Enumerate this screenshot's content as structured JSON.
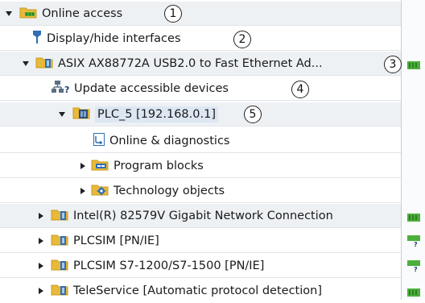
{
  "tree": {
    "root": {
      "label": "Online access"
    },
    "display_hide": {
      "label": "Display/hide interfaces"
    },
    "adapter_asix": {
      "label": "ASIX AX88772A USB2.0 to Fast Ethernet Ad..."
    },
    "update_devices": {
      "label": "Update accessible devices"
    },
    "plc": {
      "label": "PLC_5 [192.168.0.1]"
    },
    "online_diag": {
      "label": "Online & diagnostics"
    },
    "program_blocks": {
      "label": "Program blocks"
    },
    "technology_objects": {
      "label": "Technology objects"
    },
    "adapter_intel": {
      "label": "Intel(R) 82579V Gigabit Network Connection"
    },
    "plcsim": {
      "label": "PLCSIM [PN/IE]"
    },
    "plcsim_s7": {
      "label": "PLCSIM S7-1200/S7-1500 [PN/IE]"
    },
    "teleservice": {
      "label": "TeleService [Automatic protocol detection]"
    }
  },
  "callouts": [
    "1",
    "2",
    "3",
    "4",
    "5"
  ],
  "colors": {
    "folder": "#e8b93a",
    "folder_dark": "#c99a1c",
    "network_green": "#4caf3c",
    "plc_blue": "#2f6fb5",
    "arrow": "#222222"
  },
  "icons": {
    "root": "online-access-icon",
    "display_hide": "interface-plug-icon",
    "adapter": "network-adapter-folder-icon",
    "update": "update-devices-icon",
    "plc": "plc-device-icon",
    "diagnostics": "diagnostics-icon",
    "blocks": "program-blocks-icon",
    "technology": "technology-objects-icon"
  }
}
